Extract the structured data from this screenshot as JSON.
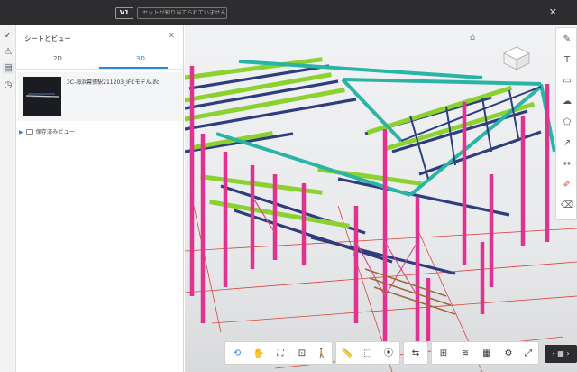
{
  "topbar": {
    "version_badge": "V1",
    "set_placeholder": "セットが割り当てられていません"
  },
  "sidebar": {
    "title": "シートとビュー",
    "tabs": [
      {
        "label": "2D"
      },
      {
        "label": "3D"
      }
    ],
    "active_tab": "3D",
    "model": {
      "name": "3C-海浜幕張駅211203_IFCモデル.ifc"
    },
    "saved_views_label": "保存済みビュー"
  },
  "viewport": {
    "colors": {
      "magenta_columns": "#e0338f",
      "green_beams": "#8bd12f",
      "navy_beams": "#2d3d7e",
      "teal_beams": "#2ab4a6",
      "red_grid": "#d9463d",
      "accent": "#2b86d8"
    }
  },
  "right_tools": [
    "markup-icon",
    "text-icon",
    "callout-icon",
    "cloud-icon",
    "polygon-icon",
    "arrow-icon",
    "dimension-icon",
    "pen-icon",
    "eraser-icon"
  ],
  "bottom_tools": [
    "orbit-icon",
    "pan-icon",
    "fit-icon",
    "zoom-window-icon",
    "first-person-icon",
    "measure-icon",
    "section-box-icon",
    "explode-icon",
    "sync-icon",
    "model-browser-icon",
    "layers-icon",
    "properties-icon",
    "settings-icon",
    "fullscreen-icon"
  ]
}
